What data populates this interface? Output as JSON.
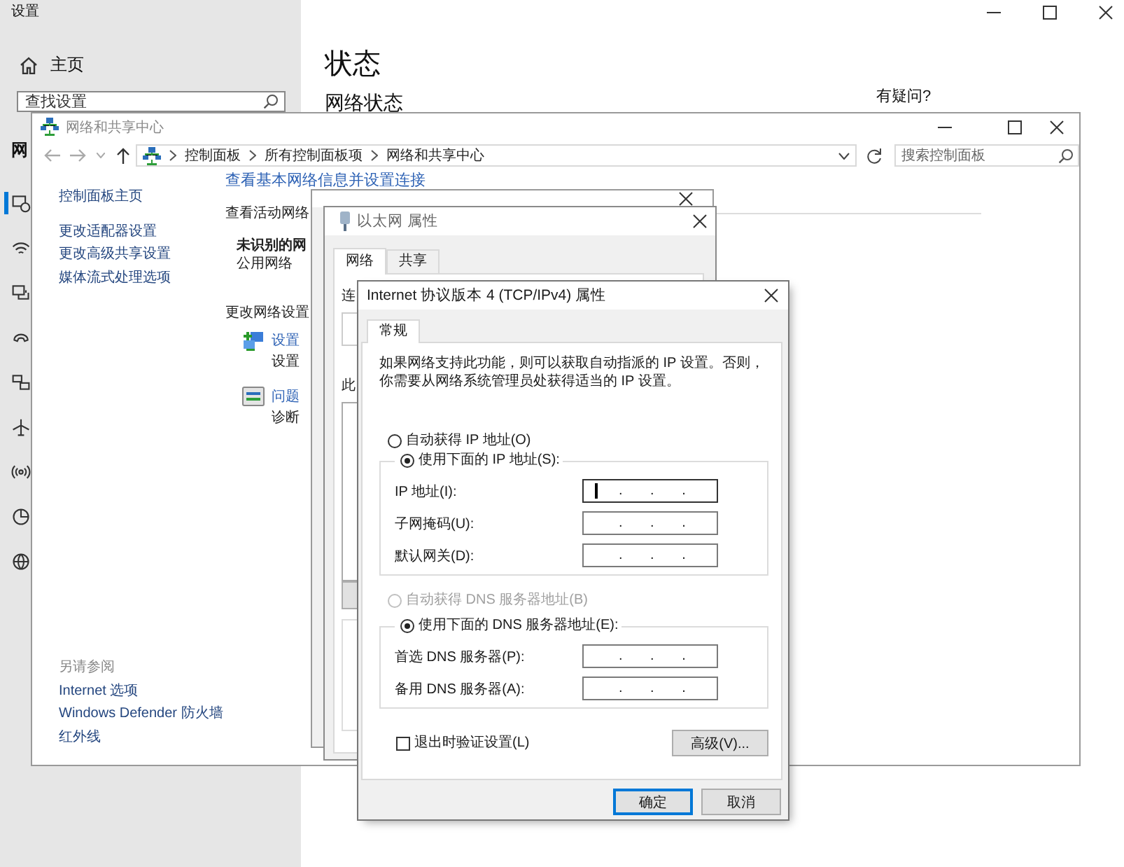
{
  "settings": {
    "title": "设置",
    "home": "主页",
    "search": {
      "placeholder": "查找设置"
    },
    "group_label": "网",
    "nav": [
      {
        "kind": "status",
        "selected": true
      },
      {
        "kind": "wifi",
        "selected": false
      },
      {
        "kind": "ethernet",
        "selected": false
      },
      {
        "kind": "dialup",
        "selected": false
      },
      {
        "kind": "vpn",
        "selected": false
      },
      {
        "kind": "airplane",
        "selected": false
      },
      {
        "kind": "hotspot",
        "selected": false
      },
      {
        "kind": "data-usage",
        "selected": false
      },
      {
        "kind": "proxy",
        "selected": false
      }
    ],
    "heading": "状态",
    "subheading": "网络状态",
    "help_title": "有疑问?"
  },
  "control_panel": {
    "title": "网络和共享中心",
    "breadcrumbs": [
      "控制面板",
      "所有控制面板项",
      "网络和共享中心"
    ],
    "search": {
      "placeholder": "搜索控制面板"
    },
    "links": [
      "控制面板主页",
      "更改适配器设置",
      "更改高级共享设置",
      "媒体流式处理选项"
    ],
    "see_also": {
      "title": "另请参阅",
      "links": [
        "Internet 选项",
        "Windows Defender 防火墙",
        "红外线"
      ]
    },
    "heading": "查看基本网络信息并设置连接",
    "active_networks": "查看活动网络",
    "network_name": "未识别的网",
    "network_type": "公用网络",
    "change_settings": "更改网络设置",
    "tasks": [
      {
        "kind": "new-connection",
        "link": "设置",
        "desc": "设置"
      },
      {
        "kind": "troubleshoot",
        "link": "问题",
        "desc": "诊断"
      }
    ]
  },
  "properties_window": {
    "title": "以太网 属性",
    "tabs": [
      {
        "label": "网络",
        "selected": true
      },
      {
        "label": "共享",
        "selected": false
      }
    ],
    "connect_label": "连",
    "items_label": "此"
  },
  "ipv4_dialog": {
    "title": "Internet 协议版本 4 (TCP/IPv4) 属性",
    "tabs": [
      {
        "label": "常规",
        "selected": true
      }
    ],
    "description": "如果网络支持此功能，则可以获取自动指派的 IP 设置。否则，你需要从网络系统管理员处获得适当的 IP 设置。",
    "ip_mode": [
      {
        "label": "自动获得 IP 地址(O)",
        "selected": false
      },
      {
        "label": "使用下面的 IP 地址(S):",
        "selected": true
      }
    ],
    "ip_fields": [
      {
        "label": "IP 地址(I):",
        "value": ". . .",
        "focused": true
      },
      {
        "label": "子网掩码(U):",
        "value": ". . .",
        "focused": false
      },
      {
        "label": "默认网关(D):",
        "value": ". . .",
        "focused": false
      }
    ],
    "dns_mode": [
      {
        "label": "自动获得 DNS 服务器地址(B)",
        "selected": false,
        "disabled": true
      },
      {
        "label": "使用下面的 DNS 服务器地址(E):",
        "selected": true,
        "disabled": false
      }
    ],
    "dns_fields": [
      {
        "label": "首选 DNS 服务器(P):",
        "value": ". . .",
        "focused": false
      },
      {
        "label": "备用 DNS 服务器(A):",
        "value": ". . .",
        "focused": false
      }
    ],
    "validate": {
      "label": "退出时验证设置(L)",
      "checked": false
    },
    "advanced_button": "高级(V)...",
    "buttons": [
      {
        "label": "确定",
        "default": true
      },
      {
        "label": "取消",
        "default": false
      }
    ]
  }
}
